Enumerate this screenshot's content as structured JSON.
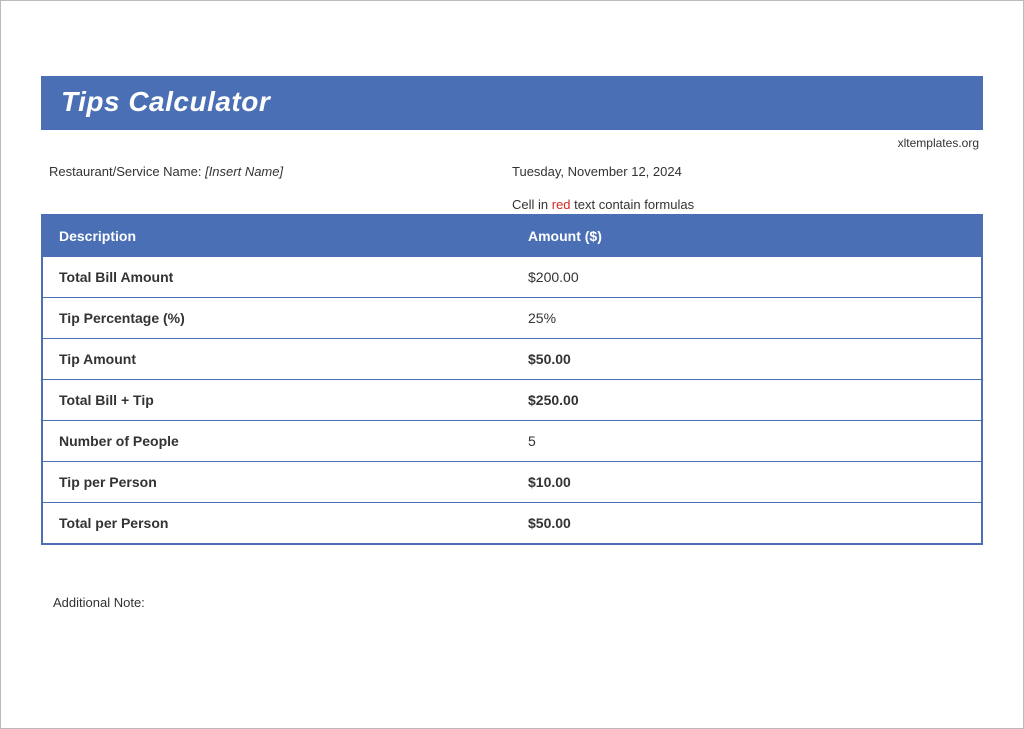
{
  "title": "Tips Calculator",
  "source": "xltemplates.org",
  "restaurant_label": "Restaurant/Service Name: ",
  "restaurant_value": "[Insert Name]",
  "date": "Tuesday, November 12, 2024",
  "formula_note_pre": "Cell in ",
  "formula_note_red": "red",
  "formula_note_post": " text contain formulas",
  "columns": {
    "description": "Description",
    "amount": "Amount ($)"
  },
  "rows": [
    {
      "label": "Total Bill Amount",
      "value": "$200.00",
      "formula": false
    },
    {
      "label": "Tip Percentage (%)",
      "value": "25%",
      "formula": false
    },
    {
      "label": "Tip Amount",
      "value": "$50.00",
      "formula": true
    },
    {
      "label": "Total Bill + Tip",
      "value": "$250.00",
      "formula": true
    },
    {
      "label": "Number of People",
      "value": "5",
      "formula": false
    },
    {
      "label": "Tip per Person",
      "value": "$10.00",
      "formula": true
    },
    {
      "label": "Total per Person",
      "value": "$50.00",
      "formula": true
    }
  ],
  "additional_note_label": "Additional Note:"
}
